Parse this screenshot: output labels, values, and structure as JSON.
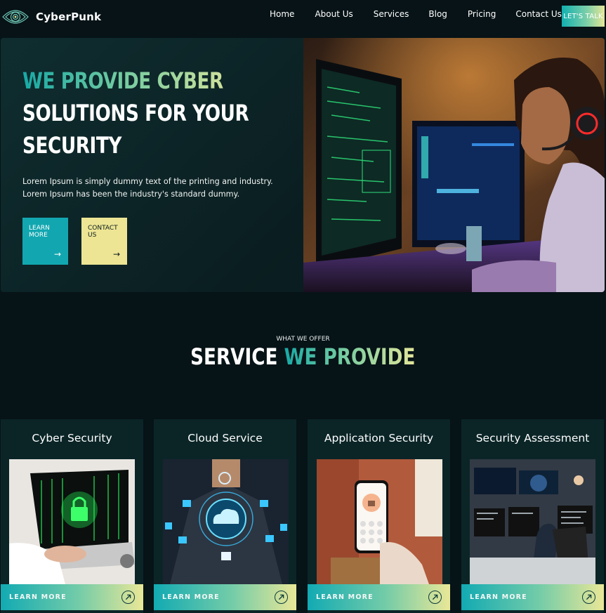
{
  "brand": {
    "name": "CyberPunk"
  },
  "nav": {
    "items": [
      "Home",
      "About Us",
      "Services",
      "Blog",
      "Pricing",
      "Contact Us"
    ],
    "cta": "LET'S TALK"
  },
  "hero": {
    "title_grad": "WE PROVIDE CYBER",
    "title_line2": "SOLUTIONS FOR YOUR",
    "title_line3": "SECURITY",
    "text": "Lorem Ipsum is simply dummy text of the printing and industry. Lorem Ipsum has been the industry's standard dummy.",
    "btn_learn": "LEARN MORE",
    "btn_contact": "CONTACT US"
  },
  "services": {
    "eyebrow": "WHAT WE OFFER",
    "title_plain": "SERVICE",
    "title_grad": "WE PROVIDE",
    "cards": [
      {
        "title": "Cyber Security",
        "cta": "LEARN MORE"
      },
      {
        "title": "Cloud Service",
        "cta": "LEARN MORE"
      },
      {
        "title": "Application Security",
        "cta": "LEARN MORE"
      },
      {
        "title": "Security Assessment",
        "cta": "LEARN MORE"
      }
    ]
  },
  "colors": {
    "teal": "#12a7b0",
    "yellow": "#ede594",
    "bg": "#061317"
  }
}
